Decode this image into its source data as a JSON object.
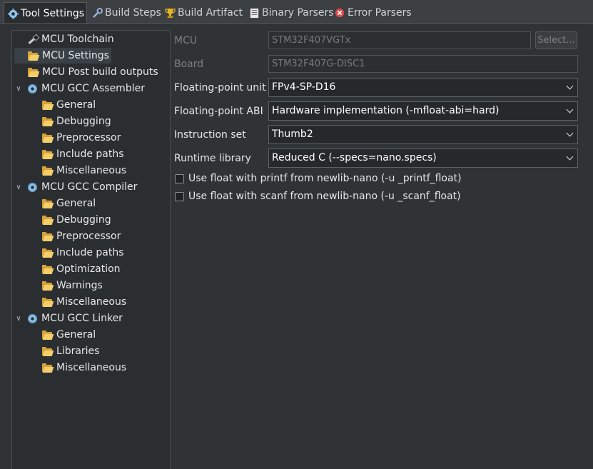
{
  "tabs": [
    {
      "label": "Tool Settings",
      "icon": "gear-icon",
      "active": true
    },
    {
      "label": "Build Steps",
      "icon": "wrench-icon",
      "active": false
    },
    {
      "label": "Build Artifact",
      "icon": "trophy-icon",
      "active": false
    },
    {
      "label": "Binary Parsers",
      "icon": "document-icon",
      "active": false
    },
    {
      "label": "Error Parsers",
      "icon": "error-icon",
      "active": false
    }
  ],
  "tree": [
    {
      "label": "MCU Toolchain",
      "icon": "wand-icon"
    },
    {
      "label": "MCU Settings",
      "icon": "folder-icon",
      "selected": true
    },
    {
      "label": "MCU Post build outputs",
      "icon": "folder-icon"
    },
    {
      "label": "MCU GCC Assembler",
      "icon": "gear-icon",
      "expanded": true
    },
    {
      "label": "General",
      "icon": "folder-icon"
    },
    {
      "label": "Debugging",
      "icon": "folder-icon"
    },
    {
      "label": "Preprocessor",
      "icon": "folder-icon"
    },
    {
      "label": "Include paths",
      "icon": "folder-icon"
    },
    {
      "label": "Miscellaneous",
      "icon": "folder-icon"
    },
    {
      "label": "MCU GCC Compiler",
      "icon": "gear-icon",
      "expanded": true
    },
    {
      "label": "General",
      "icon": "folder-icon"
    },
    {
      "label": "Debugging",
      "icon": "folder-icon"
    },
    {
      "label": "Preprocessor",
      "icon": "folder-icon"
    },
    {
      "label": "Include paths",
      "icon": "folder-icon"
    },
    {
      "label": "Optimization",
      "icon": "folder-icon"
    },
    {
      "label": "Warnings",
      "icon": "folder-icon"
    },
    {
      "label": "Miscellaneous",
      "icon": "folder-icon"
    },
    {
      "label": "MCU GCC Linker",
      "icon": "gear-icon",
      "expanded": true
    },
    {
      "label": "General",
      "icon": "folder-icon"
    },
    {
      "label": "Libraries",
      "icon": "folder-icon"
    },
    {
      "label": "Miscellaneous",
      "icon": "folder-icon"
    }
  ],
  "form": {
    "mcu": {
      "label": "MCU",
      "value": "STM32F407VGTx",
      "button": "Select..."
    },
    "board": {
      "label": "Board",
      "value": "STM32F407G-DISC1"
    },
    "fpu": {
      "label": "Floating-point unit",
      "value": "FPv4-SP-D16"
    },
    "abi": {
      "label": "Floating-point ABI",
      "value": "Hardware implementation (-mfloat-abi=hard)"
    },
    "instruction_set": {
      "label": "Instruction set",
      "value": "Thumb2"
    },
    "runtime": {
      "label": "Runtime library",
      "value": "Reduced C (--specs=nano.specs)"
    },
    "printf_float": {
      "label": "Use float with printf from newlib-nano (-u _printf_float)",
      "checked": false
    },
    "scanf_float": {
      "label": "Use float with scanf from newlib-nano (-u _scanf_float)",
      "checked": false
    }
  },
  "colors": {
    "background": "#2f3336",
    "tree_background": "#2b2e31",
    "selection": "#394046",
    "folder": "#d9a13b"
  }
}
